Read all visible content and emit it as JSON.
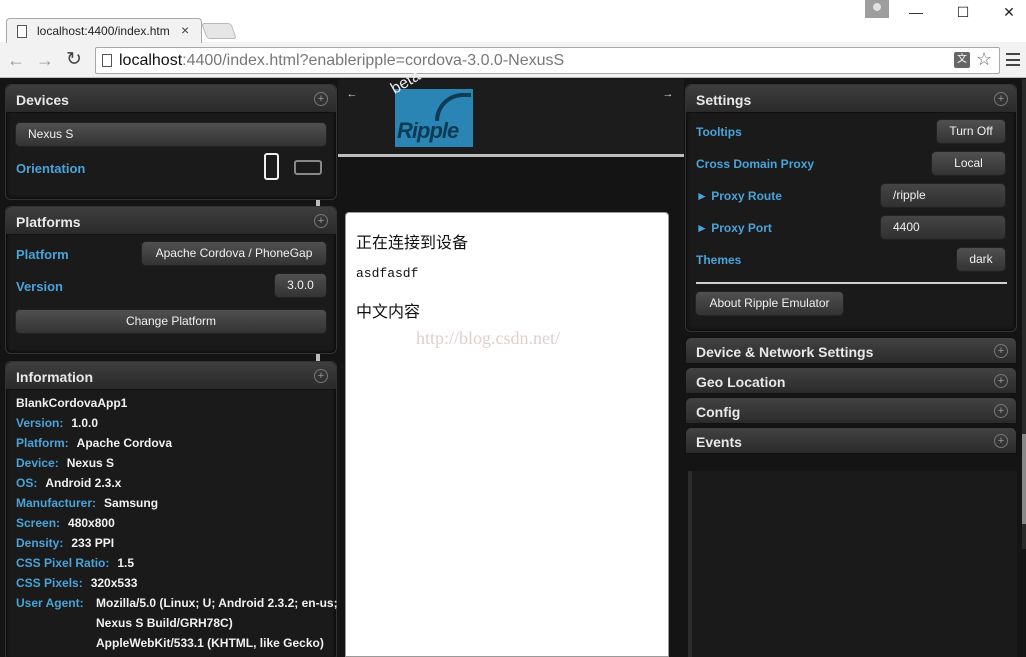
{
  "browser": {
    "tab_title": "localhost:4400/index.htm",
    "tab_close": "×",
    "url_host": "localhost",
    "url_rest": ":4400/index.html?enableripple=cordova-3.0.0-NexusS",
    "back_glyph": "←",
    "forward_glyph": "→",
    "reload_glyph": "↻",
    "translate_glyph": "文",
    "star_glyph": "☆",
    "minimize_glyph": "—",
    "maximize_glyph": "☐",
    "close_glyph": "✕"
  },
  "devices": {
    "title": "Devices",
    "selected_device": "Nexus S",
    "orientation_label": "Orientation"
  },
  "platforms": {
    "title": "Platforms",
    "platform_label": "Platform",
    "platform_value": "Apache Cordova / PhoneGap",
    "version_label": "Version",
    "version_value": "3.0.0",
    "change_button": "Change Platform"
  },
  "information": {
    "title": "Information",
    "app_name": "BlankCordovaApp1",
    "rows": [
      {
        "key": "Version:",
        "value": "1.0.0"
      },
      {
        "key": "Platform:",
        "value": "Apache Cordova"
      },
      {
        "key": "Device:",
        "value": "Nexus S"
      },
      {
        "key": "OS:",
        "value": "Android 2.3.x"
      },
      {
        "key": "Manufacturer:",
        "value": "Samsung"
      },
      {
        "key": "Screen:",
        "value": "480x800"
      },
      {
        "key": "Density:",
        "value": "233 PPI"
      },
      {
        "key": "CSS Pixel Ratio:",
        "value": "1.5"
      },
      {
        "key": "CSS Pixels:",
        "value": "320x533"
      }
    ],
    "user_agent_label": "User Agent:",
    "user_agent_lines": [
      "Mozilla/5.0 (Linux; U; Android 2.3.2; en-us;",
      "Nexus S Build/GRH78C)",
      "AppleWebKit/533.1 (KHTML, like Gecko)"
    ]
  },
  "center": {
    "beta_label": "beta",
    "logo_text": "Ripple",
    "left_arrow": "←",
    "right_arrow": "→",
    "device_lines": [
      "正在连接到设备",
      "asdfasdf",
      "中文内容"
    ],
    "watermark": "http://blog.csdn.net/"
  },
  "settings": {
    "title": "Settings",
    "tooltips_label": "Tooltips",
    "tooltips_button": "Turn Off",
    "cdp_label": "Cross Domain Proxy",
    "cdp_value": "Local",
    "proxy_route_label": "► Proxy Route",
    "proxy_route_value": "/ripple",
    "proxy_port_label": "► Proxy Port",
    "proxy_port_value": "4400",
    "themes_label": "Themes",
    "themes_value": "dark",
    "about_button": "About Ripple Emulator"
  },
  "right_panels": [
    {
      "title": "Device & Network Settings"
    },
    {
      "title": "Geo Location"
    },
    {
      "title": "Config"
    },
    {
      "title": "Events"
    }
  ],
  "collapse_glyph": "+",
  "colors": {
    "accent": "#4aa3d9",
    "panel": "#1a1a1a",
    "logo": "#2a85b5"
  }
}
